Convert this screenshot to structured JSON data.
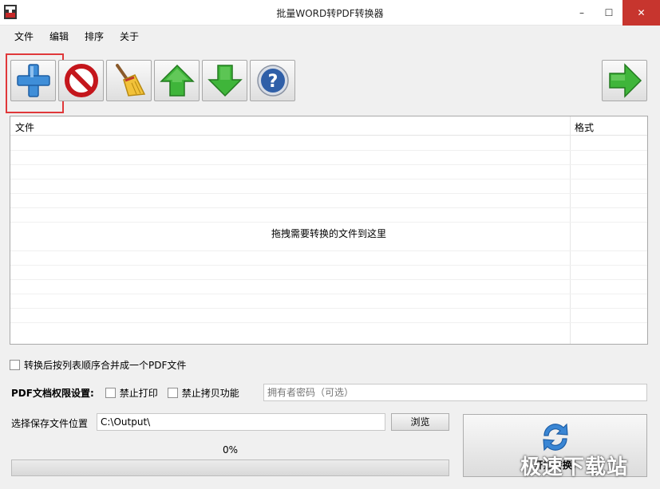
{
  "window": {
    "title": "批量WORD转PDF转换器",
    "controls": {
      "minimize": "–",
      "maximize": "☐",
      "close": "✕"
    }
  },
  "menu": [
    "文件",
    "编辑",
    "排序",
    "关于"
  ],
  "toolbar": {
    "buttons": [
      "add-file",
      "remove-file",
      "clear-list",
      "move-up",
      "move-down",
      "help"
    ],
    "start_button": "start-arrow"
  },
  "file_list": {
    "columns": [
      "文件",
      "格式"
    ],
    "empty_hint": "拖拽需要转换的文件到这里",
    "rows": []
  },
  "options": {
    "merge_label": "转换后按列表顺序合并成一个PDF文件",
    "merge_checked": false,
    "permission_label": "PDF文档权限设置:",
    "no_print_label": "禁止打印",
    "no_print_checked": false,
    "no_copy_label": "禁止拷贝功能",
    "no_copy_checked": false,
    "owner_password_placeholder": "拥有者密码（可选）",
    "owner_password_value": ""
  },
  "output": {
    "label": "选择保存文件位置",
    "path": "C:\\Output\\",
    "browse_label": "浏览"
  },
  "progress": {
    "percent_text": "0%",
    "value": 0
  },
  "start": {
    "label": "开始转换!"
  },
  "watermark": "极速下载站",
  "colors": {
    "highlight": "#e0383a",
    "close_button": "#c7352e",
    "add_blue": "#3f8ed8",
    "remove_red": "#d9242a",
    "arrow_green": "#3fb53a"
  }
}
